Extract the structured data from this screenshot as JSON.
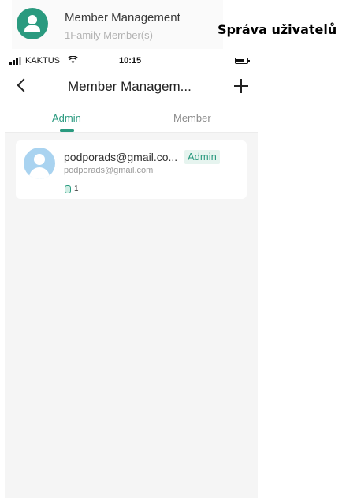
{
  "banner": {
    "title": "Member Management",
    "subtitle": "1Family Member(s)",
    "icon": "user-icon"
  },
  "caption": "Správa uživatelů",
  "status_bar": {
    "carrier": "KAKTUS",
    "time": "10:15",
    "icons": [
      "signal-icon",
      "wifi-icon",
      "battery-icon"
    ]
  },
  "navbar": {
    "title": "Member Managem...",
    "back_icon": "chevron-left-icon",
    "add_icon": "plus-icon"
  },
  "tabs": [
    {
      "label": "Admin",
      "active": true
    },
    {
      "label": "Member",
      "active": false
    }
  ],
  "members": [
    {
      "name": "podporads@gmail.co...",
      "email": "podporads@gmail.com",
      "role": "Admin",
      "device_count": "1"
    }
  ],
  "colors": {
    "accent": "#2a9a7f",
    "background": "#f5f5f5",
    "avatar_bg": "#a9d3f0"
  }
}
